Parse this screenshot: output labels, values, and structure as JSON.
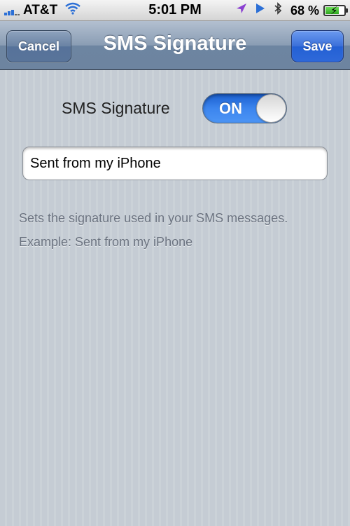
{
  "status_bar": {
    "carrier": "AT&T",
    "time": "5:01 PM",
    "battery_percent": "68 %",
    "battery_level": 0.68,
    "icons": [
      "signal-icon",
      "wifi-icon",
      "location-icon",
      "play-icon",
      "bluetooth-icon",
      "battery-icon"
    ]
  },
  "nav": {
    "title": "SMS Signature",
    "cancel_label": "Cancel",
    "save_label": "Save"
  },
  "settings": {
    "toggle_label": "SMS Signature",
    "toggle_state": "ON",
    "signature_value": "Sent from my iPhone",
    "description": "Sets the signature used in your SMS messages.",
    "example": "Example:  Sent from my iPhone"
  },
  "colors": {
    "nav_bar": "#6d84a0",
    "save_button": "#2f69d9",
    "switch_on": "#3c85ee",
    "background": "#c5ccd4"
  }
}
